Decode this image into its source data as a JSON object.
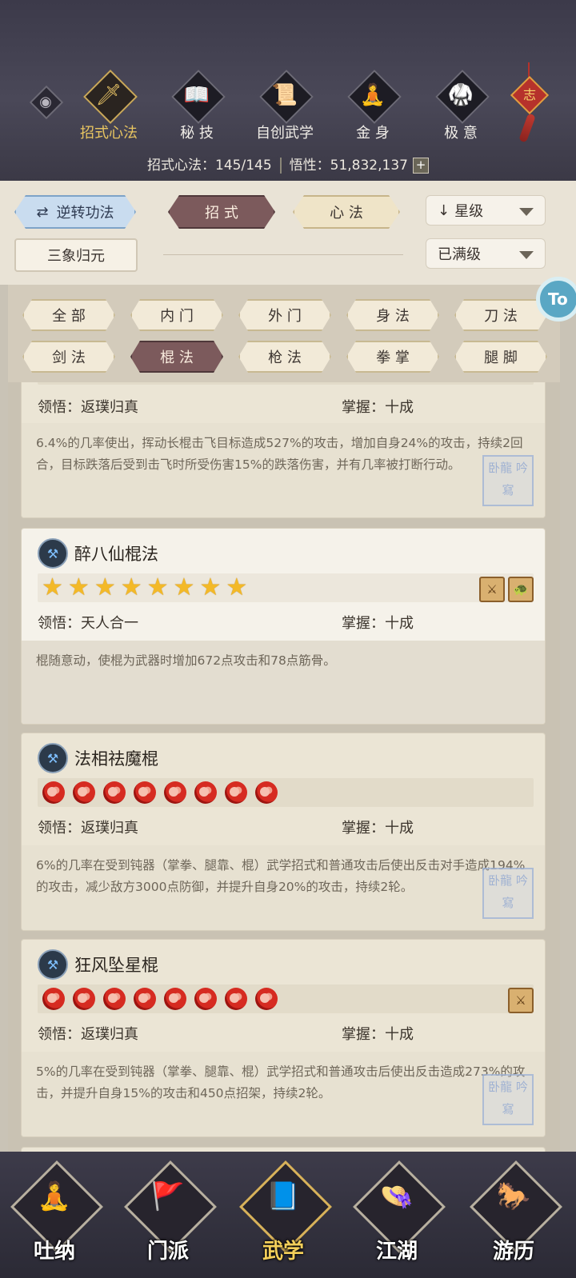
{
  "nav": {
    "eye_icon": "eye-icon",
    "items": [
      {
        "label": "招式心法",
        "icon": "sword-icon",
        "glyph": "🗡",
        "active": true
      },
      {
        "label": "秘 技",
        "icon": "book-icon",
        "glyph": "📖",
        "active": false
      },
      {
        "label": "自创武学",
        "icon": "scroll-icon",
        "glyph": "📜",
        "active": false
      },
      {
        "label": "金 身",
        "icon": "meditation-icon",
        "glyph": "🧘",
        "active": false
      },
      {
        "label": "极 意",
        "icon": "martial-pose-icon",
        "glyph": "🥋",
        "active": false
      }
    ],
    "knot_text": "志"
  },
  "stats": {
    "moves_label": "招式心法：145/145",
    "insight_label": "悟性：51,832,137",
    "plus": "+"
  },
  "filters": {
    "reverse": "逆转功法",
    "moves": "招 式",
    "mind": "心 法",
    "sort": "星级",
    "sanxiang": "三象归元",
    "status": "已满级"
  },
  "categories": [
    "全 部",
    "内 门",
    "外 门",
    "身 法",
    "刀 法",
    "剑 法",
    "棍 法",
    "枪 法",
    "拳 掌",
    "腿 脚"
  ],
  "active_category": "棍 法",
  "side_badge": "To",
  "skills": [
    {
      "name": "",
      "insight": "领悟：返璞归真",
      "mastery": "掌握：十成",
      "desc": "6.4%的几率使出，挥动长棍击飞目标造成527%的攻击，增加自身24%的攻击，持续2回合，目标跌落后受到击飞时所受伤害15%的跌落伤害，并有几率被打断行动。",
      "seal": "卧龍 吟寫"
    },
    {
      "name": "醉八仙棍法",
      "stars": 8,
      "star_glyph": "★",
      "insight": "领悟：天人合一",
      "mastery": "掌握：十成",
      "desc": "棍随意动，使棍为武器时增加672点攻击和78点筋骨。",
      "badges": [
        "⚔",
        "🐢"
      ]
    },
    {
      "name": "法相祛魔棍",
      "dots": 8,
      "insight": "领悟：返璞归真",
      "mastery": "掌握：十成",
      "desc": "6%的几率在受到钝器（掌拳、腿靠、棍）武学招式和普通攻击后使出反击对手造成194%的攻击，减少敌方3000点防御，并提升自身20%的攻击，持续2轮。",
      "seal": "卧龍 吟寫"
    },
    {
      "name": "狂风坠星棍",
      "dots": 8,
      "insight": "领悟：返璞归真",
      "mastery": "掌握：十成",
      "desc": "5%的几率在受到钝器（掌拳、腿靠、棍）武学招式和普通攻击后使出反击造成273%的攻击，并提升自身15%的攻击和450点招架，持续2轮。",
      "badges": [
        "⚔"
      ],
      "seal": "卧龍 吟寫"
    }
  ],
  "bottom_tabs": [
    {
      "label": "吐纳",
      "icon": "monk-icon",
      "glyph": "🧘",
      "active": false
    },
    {
      "label": "门派",
      "icon": "banner-icon",
      "glyph": "🚩",
      "active": false
    },
    {
      "label": "武学",
      "icon": "manual-icon",
      "glyph": "📘",
      "active": true
    },
    {
      "label": "江湖",
      "icon": "straw-hat-icon",
      "glyph": "👒",
      "active": false
    },
    {
      "label": "游历",
      "icon": "horse-icon",
      "glyph": "🐎",
      "active": false
    }
  ],
  "colors": {
    "accent_gold": "#e8c561",
    "tab_active": "#7c5a5c",
    "blue_button": "#c9dcef"
  }
}
